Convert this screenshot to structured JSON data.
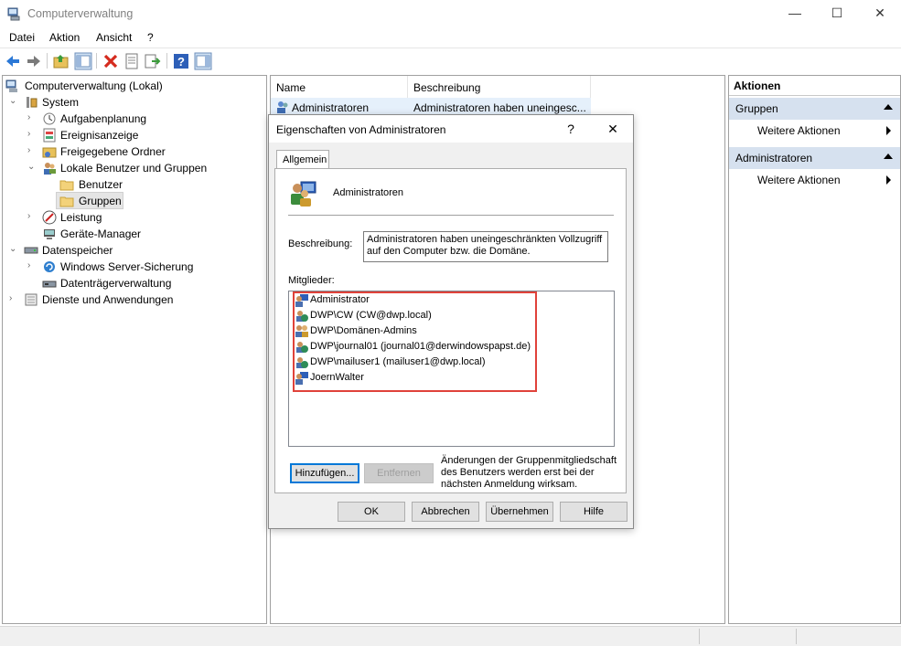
{
  "window": {
    "title": "Computerverwaltung",
    "min": "—",
    "max": "☐",
    "close": "✕"
  },
  "menu": [
    "Datei",
    "Aktion",
    "Ansicht",
    "?"
  ],
  "tree": [
    {
      "label": "Computerverwaltung (Lokal)",
      "icon": "computer-management-icon"
    },
    {
      "label": "System",
      "icon": "system-tools-icon"
    },
    {
      "label": "Aufgabenplanung",
      "icon": "task-scheduler-icon"
    },
    {
      "label": "Ereignisanzeige",
      "icon": "event-viewer-icon"
    },
    {
      "label": "Freigegebene Ordner",
      "icon": "shared-folders-icon"
    },
    {
      "label": "Lokale Benutzer und Gruppen",
      "icon": "local-users-groups-icon"
    },
    {
      "label": "Benutzer",
      "icon": "folder-icon"
    },
    {
      "label": "Gruppen",
      "icon": "folder-icon"
    },
    {
      "label": "Leistung",
      "icon": "performance-icon"
    },
    {
      "label": "Geräte-Manager",
      "icon": "device-manager-icon"
    },
    {
      "label": "Datenspeicher",
      "icon": "storage-icon"
    },
    {
      "label": "Windows Server-Sicherung",
      "icon": "backup-icon"
    },
    {
      "label": "Datenträgerverwaltung",
      "icon": "disk-management-icon"
    },
    {
      "label": "Dienste und Anwendungen",
      "icon": "services-icon"
    }
  ],
  "list": {
    "columns": [
      "Name",
      "Beschreibung"
    ],
    "rows": [
      {
        "name": "Administratoren",
        "desc": "Administratoren haben uneingesc..."
      }
    ]
  },
  "actions": {
    "header": "Aktionen",
    "groups": [
      {
        "title": "Gruppen",
        "item": "Weitere Aktionen"
      },
      {
        "title": "Administratoren",
        "item": "Weitere Aktionen"
      }
    ]
  },
  "dialog": {
    "title": "Eigenschaften von Administratoren",
    "help": "?",
    "close": "✕",
    "tab": "Allgemein",
    "group_name": "Administratoren",
    "description_label": "Beschreibung:",
    "description_value": "Administratoren haben uneingeschränkten Vollzugriff auf den Computer bzw. die Domäne.",
    "members_label": "Mitglieder:",
    "members": [
      {
        "name": "Administrator",
        "type": "user"
      },
      {
        "name": "DWP\\CW (CW@dwp.local)",
        "type": "domain-user"
      },
      {
        "name": "DWP\\Domänen-Admins",
        "type": "domain-group"
      },
      {
        "name": "DWP\\journal01 (journal01@derwindowspapst.de)",
        "type": "domain-user"
      },
      {
        "name": "DWP\\mailuser1 (mailuser1@dwp.local)",
        "type": "domain-user"
      },
      {
        "name": "JoernWalter",
        "type": "user"
      }
    ],
    "add_button": "Hinzufügen...",
    "remove_button": "Entfernen",
    "note": "Änderungen der Gruppenmitgliedschaft des Benutzers werden erst bei der nächsten Anmeldung wirksam.",
    "ok": "OK",
    "cancel": "Abbrechen",
    "apply": "Übernehmen",
    "helpbtn": "Hilfe"
  }
}
